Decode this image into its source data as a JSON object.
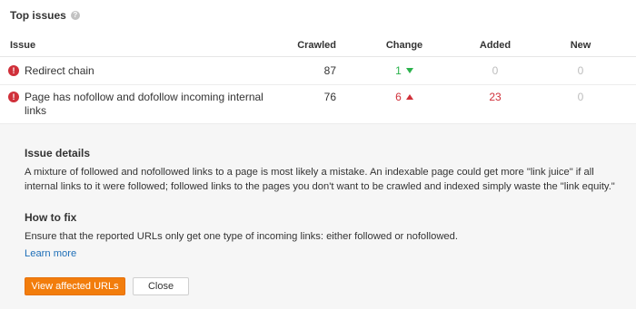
{
  "panel": {
    "title": "Top issues",
    "help_icon_glyph": "?"
  },
  "table": {
    "headers": {
      "issue": "Issue",
      "crawled": "Crawled",
      "change": "Change",
      "added": "Added",
      "new": "New"
    },
    "rows": [
      {
        "issue": "Redirect chain",
        "severity_icon": "!",
        "crawled": "87",
        "change": "1",
        "change_direction": "down",
        "added": "0",
        "new": "0"
      },
      {
        "issue": "Page has nofollow and dofollow incoming internal links",
        "severity_icon": "!",
        "crawled": "76",
        "change": "6",
        "change_direction": "up",
        "added": "23",
        "new": "0"
      }
    ]
  },
  "details": {
    "issue_details_title": "Issue details",
    "issue_details_text": "A mixture of followed and nofollowed links to a page is most likely a mistake. An indexable page could get more \"link juice\" if all internal links to it were followed; followed links to the pages you don't want to be crawled and indexed simply waste the \"link equity.\"",
    "how_to_fix_title": "How to fix",
    "how_to_fix_text": "Ensure that the reported URLs only get one type of incoming links: either followed or nofollowed.",
    "learn_more": "Learn more",
    "view_button": "View affected URLs",
    "close_button": "Close"
  },
  "colors": {
    "accent_orange": "#f27d0c",
    "error_red": "#d0303a",
    "positive_green": "#2bb24c",
    "link_blue": "#1f6fb8",
    "details_bg": "#f6f6f6"
  }
}
